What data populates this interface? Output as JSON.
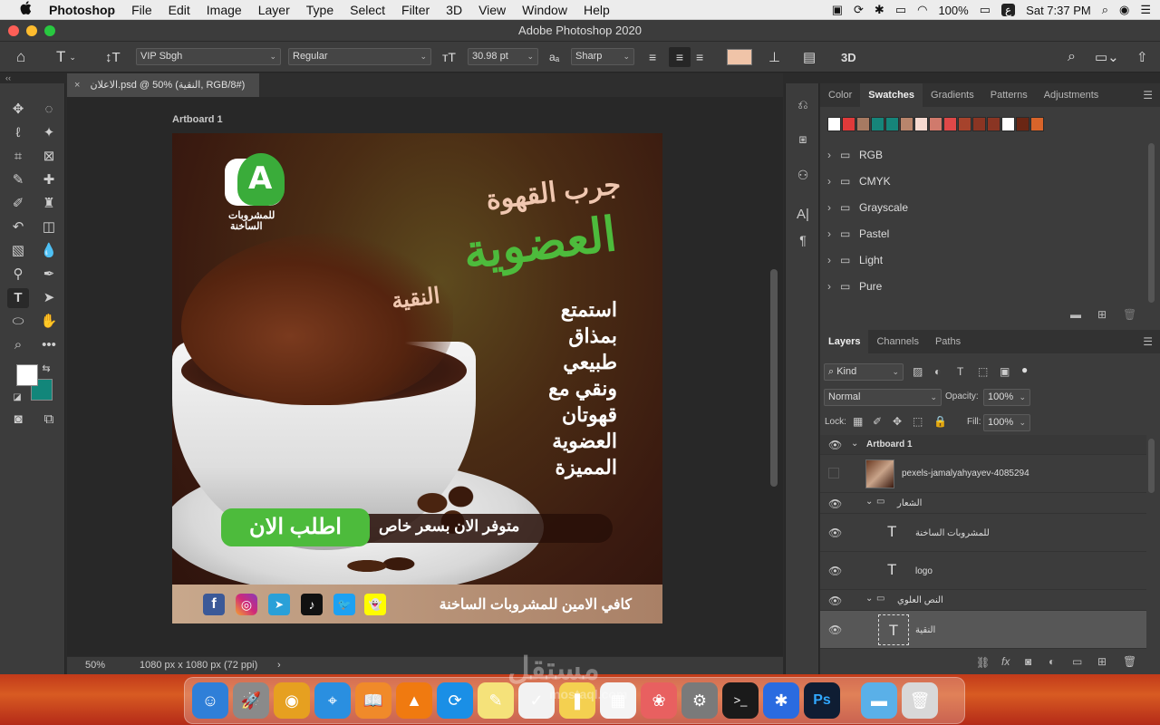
{
  "menubar": {
    "apple": "",
    "app_name": "Photoshop",
    "items": [
      "File",
      "Edit",
      "Image",
      "Layer",
      "Type",
      "Select",
      "Filter",
      "3D",
      "View",
      "Window",
      "Help"
    ],
    "battery": "100%",
    "input_lang": "ع",
    "clock": "Sat 7:37 PM"
  },
  "window": {
    "title": "Adobe Photoshop 2020"
  },
  "options": {
    "font_family": "VIP Sbgh",
    "font_style": "Regular",
    "font_size": "30.98 pt",
    "aa_label": "aₐ",
    "antialias": "Sharp",
    "threeD": "3D",
    "text_color": "#f0c4a8"
  },
  "document": {
    "tab_label": "الاعلان.psd @ 50% (النقية, RGB/8#)",
    "close_glyph": "×",
    "artboard_label": "Artboard 1",
    "zoom": "50%",
    "info": "1080 px x 1080 px (72 ppi)"
  },
  "ad": {
    "logo_letter": "A",
    "logo_caption_1": "للمشروبات",
    "logo_caption_2": "الساخنة",
    "headline_1": "جرب القهوة",
    "headline_2": "العضوية",
    "headline_3": "النقية",
    "body": [
      "استمتع",
      "بمذاق",
      "طبيعي",
      "ونقي مع",
      "قهوتان",
      "العضوية",
      "المميزة"
    ],
    "cta_button": "اطلب الان",
    "cta_text": "متوفر الان بسعر خاص",
    "footer": "كافي الامين للمشروبات الساخنة",
    "social": [
      "f",
      "◎",
      "➤",
      "♪",
      "🐦",
      "👻"
    ]
  },
  "tools": {
    "fg_color": "#ffffff",
    "bg_color": "#12867a"
  },
  "swatches": {
    "tabs": [
      "Color",
      "Swatches",
      "Gradients",
      "Patterns",
      "Adjustments"
    ],
    "active_tab": "Swatches",
    "colors": [
      "#ffffff",
      "#e03a3a",
      "#a77a62",
      "#16857a",
      "#16857a",
      "#b8856c",
      "#f5d9d0",
      "#d07a6c",
      "#de4848",
      "#a6432c",
      "#8a3523",
      "#8a3523",
      "#ffffff",
      "#6a2614",
      "#d8642a"
    ],
    "folders": [
      "RGB",
      "CMYK",
      "Grayscale",
      "Pastel",
      "Light",
      "Pure"
    ]
  },
  "layers": {
    "tabs": [
      "Layers",
      "Channels",
      "Paths"
    ],
    "active_tab": "Layers",
    "kind": "Kind",
    "blend": "Normal",
    "opacity_label": "Opacity:",
    "opacity": "100%",
    "lock_label": "Lock:",
    "fill_label": "Fill:",
    "fill": "100%",
    "items": [
      {
        "name": "Artboard 1",
        "kind": "artboard"
      },
      {
        "name": "pexels-jamalyahyayev-4085294",
        "kind": "image"
      },
      {
        "name": "الشعار",
        "kind": "group"
      },
      {
        "name": "للمشروبات الساخنة",
        "kind": "text"
      },
      {
        "name": "logo",
        "kind": "text"
      },
      {
        "name": "النص العلوي",
        "kind": "group"
      },
      {
        "name": "النقية",
        "kind": "text"
      }
    ]
  },
  "dock": {
    "watermark_text": "مستقل",
    "watermark_sub": "mostaql.com",
    "apps": [
      {
        "name": "Finder",
        "glyph": "☺",
        "color": "#2f7fd8"
      },
      {
        "name": "Launchpad",
        "glyph": "🚀",
        "color": "#8a8a8a"
      },
      {
        "name": "Chrome",
        "glyph": "◉",
        "color": "#e6a020"
      },
      {
        "name": "Safari",
        "glyph": "⌖",
        "color": "#2a8fe0"
      },
      {
        "name": "Books",
        "glyph": "📖",
        "color": "#f08a2a"
      },
      {
        "name": "VLC",
        "glyph": "▲",
        "color": "#f07a10"
      },
      {
        "name": "SHAREit",
        "glyph": "⟳",
        "color": "#1a8fe6"
      },
      {
        "name": "Notes",
        "glyph": "✎",
        "color": "#f5e27a"
      },
      {
        "name": "Reminders",
        "glyph": "✓",
        "color": "#f2f2f2"
      },
      {
        "name": "Stickies",
        "glyph": "❚",
        "color": "#f4d050"
      },
      {
        "name": "Calendar",
        "glyph": "▦",
        "color": "#f4f4f4"
      },
      {
        "name": "Photos",
        "glyph": "❀",
        "color": "#e86060"
      },
      {
        "name": "System Preferences",
        "glyph": "⚙",
        "color": "#7a7a7a"
      },
      {
        "name": "Terminal",
        "glyph": ">_",
        "color": "#1a1a1a"
      },
      {
        "name": "Bluetooth",
        "glyph": "✱",
        "color": "#2a6be0"
      },
      {
        "name": "Photoshop",
        "glyph": "Ps",
        "color": "#0f1d33"
      },
      {
        "name": "Folder",
        "glyph": "▬",
        "color": "#5ab0e8"
      },
      {
        "name": "Trash",
        "glyph": "🗑",
        "color": "#d8d8d8"
      }
    ]
  }
}
